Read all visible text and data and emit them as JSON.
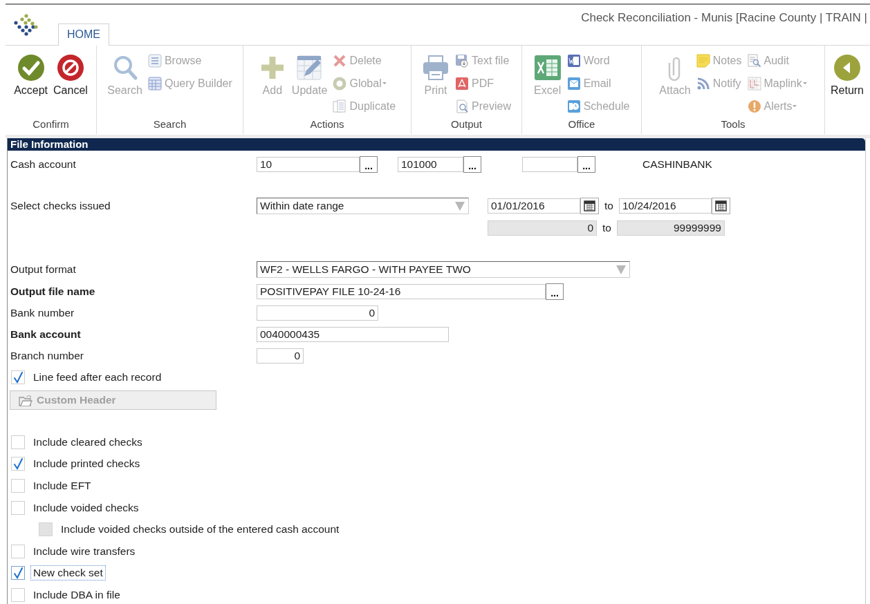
{
  "window": {
    "title": "Check Reconciliation - Munis [Racine County | TRAIN |"
  },
  "ribbon": {
    "tabs": [
      {
        "label": "HOME",
        "selected": true
      }
    ],
    "groups": [
      {
        "label": "Confirm",
        "columns": [
          [
            {
              "label": "Accept",
              "kind": "large",
              "disabled": false,
              "dropdown": false
            }
          ],
          [
            {
              "label": "Cancel",
              "kind": "large",
              "disabled": false,
              "dropdown": false
            }
          ]
        ]
      },
      {
        "label": "Search",
        "columns": [
          [
            {
              "label": "Search",
              "kind": "large",
              "disabled": true,
              "dropdown": false
            }
          ],
          [
            {
              "label": "Browse",
              "kind": "small",
              "disabled": true,
              "dropdown": false
            },
            {
              "label": "Query Builder",
              "kind": "small",
              "disabled": true,
              "dropdown": false
            }
          ]
        ]
      },
      {
        "label": "Actions",
        "columns": [
          [
            {
              "label": "Add",
              "kind": "large",
              "disabled": true,
              "dropdown": false
            }
          ],
          [
            {
              "label": "Update",
              "kind": "large",
              "disabled": true,
              "dropdown": false
            }
          ],
          [
            {
              "label": "Delete",
              "kind": "small",
              "disabled": true,
              "dropdown": false
            },
            {
              "label": "Global",
              "kind": "small",
              "disabled": true,
              "dropdown": true
            },
            {
              "label": "Duplicate",
              "kind": "small",
              "disabled": true,
              "dropdown": false
            }
          ]
        ]
      },
      {
        "label": "Output",
        "columns": [
          [
            {
              "label": "Print",
              "kind": "large",
              "disabled": true,
              "dropdown": false
            }
          ],
          [
            {
              "label": "Text file",
              "kind": "small",
              "disabled": true,
              "dropdown": false
            },
            {
              "label": "PDF",
              "kind": "small",
              "disabled": true,
              "dropdown": false
            },
            {
              "label": "Preview",
              "kind": "small",
              "disabled": true,
              "dropdown": false
            }
          ]
        ]
      },
      {
        "label": "Office",
        "columns": [
          [
            {
              "label": "Excel",
              "kind": "large",
              "disabled": true,
              "dropdown": false
            }
          ],
          [
            {
              "label": "Word",
              "kind": "small",
              "disabled": true,
              "dropdown": false
            },
            {
              "label": "Email",
              "kind": "small",
              "disabled": true,
              "dropdown": false
            },
            {
              "label": "Schedule",
              "kind": "small",
              "disabled": true,
              "dropdown": false
            }
          ]
        ]
      },
      {
        "label": "Tools",
        "columns": [
          [
            {
              "label": "Attach",
              "kind": "large",
              "disabled": true,
              "dropdown": false
            }
          ],
          [
            {
              "label": "Notes",
              "kind": "small",
              "disabled": true,
              "dropdown": false
            },
            {
              "label": "Notify",
              "kind": "small",
              "disabled": true,
              "dropdown": false
            }
          ],
          [
            {
              "label": "Audit",
              "kind": "small",
              "disabled": true,
              "dropdown": false
            },
            {
              "label": "Maplink",
              "kind": "small",
              "disabled": true,
              "dropdown": true
            },
            {
              "label": "Alerts",
              "kind": "small",
              "disabled": true,
              "dropdown": true
            }
          ]
        ]
      },
      {
        "columns": [
          [
            {
              "label": "Return",
              "kind": "large",
              "disabled": false,
              "dropdown": false
            }
          ]
        ]
      }
    ]
  },
  "section": {
    "title": "File Information"
  },
  "form": {
    "cash_account": {
      "label": "Cash account",
      "lookups": [
        {
          "value": "10",
          "button": "..."
        },
        {
          "value": "101000",
          "button": "..."
        },
        {
          "button": "..."
        }
      ],
      "description": "CASHINBANK"
    },
    "checks_issued": {
      "label": "Select checks issued",
      "selection": "Within date range",
      "date_from": "01/01/2016",
      "date_separator": "to",
      "date_to": "10/24/2016",
      "number_from": "0",
      "number_separator": "to",
      "number_to": "99999999"
    },
    "output_format": {
      "label": "Output format",
      "value": "WF2 - WELLS FARGO - WITH PAYEE TWO"
    },
    "output_file_name": {
      "label": "Output file name",
      "value": "POSITIVEPAY FILE 10-24-16",
      "button": "...",
      "required": true
    },
    "bank_number": {
      "label": "Bank number",
      "value": "0",
      "required": false
    },
    "bank_account": {
      "label": "Bank account",
      "value": "0040000435",
      "required": true
    },
    "branch_number": {
      "label": "Branch number",
      "value": "0",
      "required": false
    },
    "line_feed": {
      "label": "Line feed after each record",
      "checked": true
    },
    "custom_header": {
      "label": "Custom Header",
      "disabled": true
    },
    "options": [
      {
        "label": "Include cleared checks",
        "checked": false,
        "disabled": false,
        "focused": false
      },
      {
        "label": "Include printed checks",
        "checked": true,
        "disabled": false,
        "focused": false
      },
      {
        "label": "Include EFT",
        "checked": false,
        "disabled": false,
        "focused": false
      },
      {
        "label": "Include voided checks",
        "checked": false,
        "disabled": false,
        "focused": false,
        "children": [
          {
            "label": "Include voided checks outside of the entered cash account",
            "checked": false,
            "disabled": true,
            "focused": false
          }
        ]
      },
      {
        "label": "Include wire transfers",
        "checked": false,
        "disabled": false,
        "focused": false
      },
      {
        "label": "New check set",
        "checked": true,
        "disabled": false,
        "focused": true
      },
      {
        "label": "Include DBA in file",
        "checked": false,
        "disabled": false,
        "focused": false
      }
    ]
  }
}
